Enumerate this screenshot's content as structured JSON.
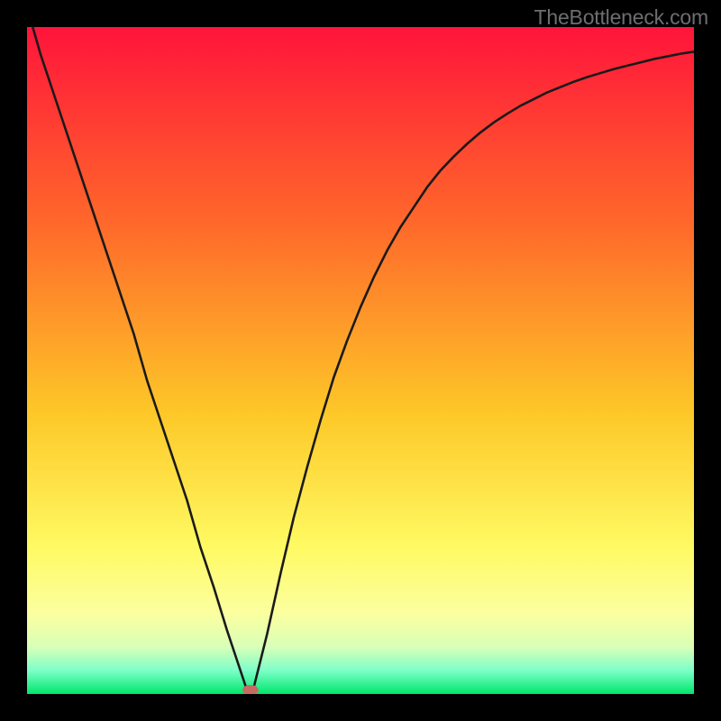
{
  "watermark": "TheBottleneck.com",
  "colors": {
    "top": "#ff143b",
    "mid1": "#ff6a2a",
    "mid2": "#fdc828",
    "mid3": "#fffa63",
    "mid4": "#fbffa0",
    "mid5": "#d8ffb8",
    "mid6": "#7cffc8",
    "bottom": "#00e66c",
    "curve_stroke": "#1a1a1a",
    "marker_fill": "#c86a62",
    "background": "#000000"
  },
  "chart_data": {
    "type": "line",
    "title": "",
    "xlabel": "",
    "ylabel": "",
    "x": [
      0.0,
      0.02,
      0.04,
      0.06,
      0.08,
      0.1,
      0.12,
      0.14,
      0.16,
      0.18,
      0.2,
      0.22,
      0.24,
      0.26,
      0.28,
      0.3,
      0.32,
      0.33,
      0.335,
      0.34,
      0.36,
      0.38,
      0.4,
      0.42,
      0.44,
      0.46,
      0.48,
      0.5,
      0.52,
      0.54,
      0.56,
      0.58,
      0.6,
      0.62,
      0.64,
      0.66,
      0.68,
      0.7,
      0.72,
      0.74,
      0.76,
      0.78,
      0.8,
      0.82,
      0.84,
      0.86,
      0.88,
      0.9,
      0.92,
      0.94,
      0.96,
      0.98,
      1.0
    ],
    "y": [
      1.03,
      0.96,
      0.9,
      0.84,
      0.78,
      0.72,
      0.66,
      0.6,
      0.54,
      0.47,
      0.41,
      0.35,
      0.29,
      0.22,
      0.16,
      0.095,
      0.035,
      0.005,
      0.0,
      0.01,
      0.09,
      0.18,
      0.265,
      0.34,
      0.41,
      0.475,
      0.53,
      0.58,
      0.625,
      0.665,
      0.7,
      0.73,
      0.76,
      0.785,
      0.806,
      0.825,
      0.842,
      0.857,
      0.87,
      0.882,
      0.892,
      0.902,
      0.91,
      0.918,
      0.925,
      0.931,
      0.937,
      0.942,
      0.947,
      0.952,
      0.956,
      0.96,
      0.963
    ],
    "xlim": [
      0,
      1
    ],
    "ylim": [
      0,
      1
    ],
    "marker": {
      "x": 0.335,
      "y": 0.0
    }
  }
}
